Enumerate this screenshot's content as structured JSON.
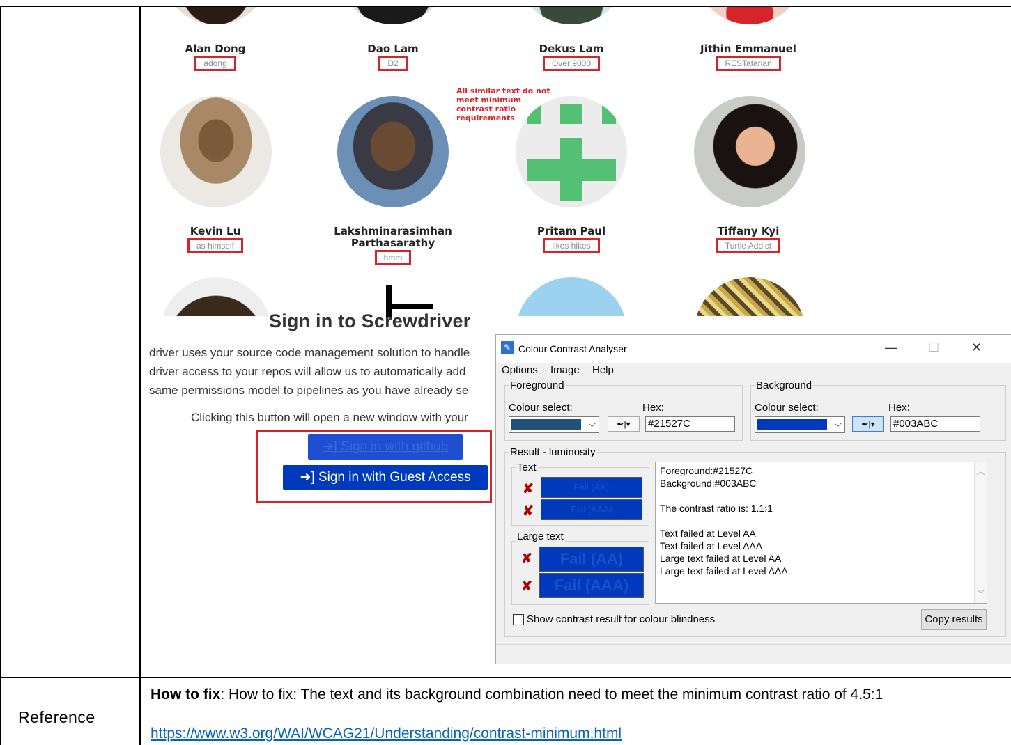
{
  "members": [
    {
      "name": "Alan Dong",
      "tag": "adong"
    },
    {
      "name": "Dao Lam",
      "tag": "D2"
    },
    {
      "name": "Dekus Lam",
      "tag": "Over 9000"
    },
    {
      "name": "Jithin Emmanuel",
      "tag": "RESTafarian"
    },
    {
      "name": "Kevin Lu",
      "tag": "as himself"
    },
    {
      "name": "Lakshminarasimhan\nParthasarathy",
      "tag": "hmm"
    },
    {
      "name": "Pritam Paul",
      "tag": "likes hikes"
    },
    {
      "name": "Tiffany Kyi",
      "tag": "Turtle Addict"
    }
  ],
  "annotation": "All similar text do not meet minimum contrast ratio requirements",
  "signin": {
    "title": "Sign in to Screwdriver",
    "para1": "driver uses your source code management solution to handle",
    "para2": "driver access to your repos will allow us to automatically add",
    "para3": "same permissions model to pipelines as you have already se",
    "click_text": "Clicking this button will open a new window with your",
    "github_button": "Sign in with github",
    "guest_button": "Sign in with Guest Access"
  },
  "analyser": {
    "title": "Colour Contrast Analyser",
    "menu": [
      "Options",
      "Image",
      "Help"
    ],
    "foreground_label": "Foreground",
    "background_label": "Background",
    "colour_select": "Colour select:",
    "hex_label": "Hex:",
    "fg_hex": "#21527C",
    "bg_hex": "#003ABC",
    "fg_color": "#21527C",
    "bg_color": "#003ABC",
    "result_label": "Result - luminosity",
    "text_label": "Text",
    "large_text_label": "Large text",
    "fail_aa": "Fail (AA)",
    "fail_aaa": "Fail (AAA)",
    "results_lines": [
      "Foreground:#21527C",
      "Background:#003ABC",
      "",
      "The contrast ratio is: 1.1:1",
      "",
      "Text failed at Level AA",
      "Text failed at Level AAA",
      "Large text failed at Level AA",
      "Large text failed at Level AAA"
    ],
    "colour_blindness": "Show contrast result for colour blindness",
    "copy_results": "Copy results"
  },
  "reference": {
    "label": "Reference",
    "how_to_fix_bold": "How to fix",
    "how_to_fix_text": ":  How to fix: The text and its background combination need to meet the minimum contrast ratio of 4.5:1",
    "link": "https://www.w3.org/WAI/WCAG21/Understanding/contrast-minimum.html"
  }
}
